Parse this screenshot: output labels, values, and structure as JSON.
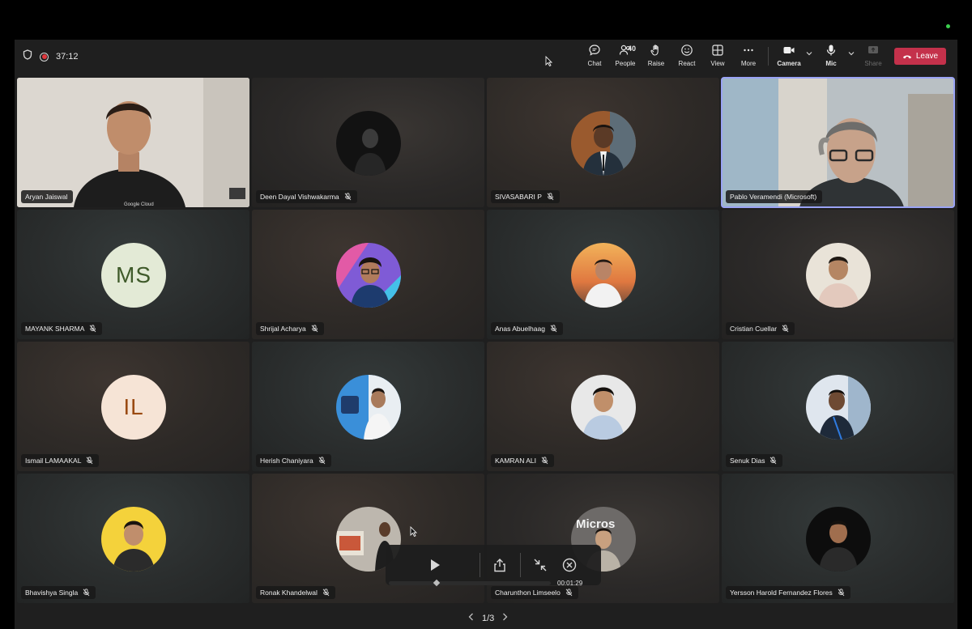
{
  "topbar": {
    "timer": "37:12",
    "buttons": {
      "chat": "Chat",
      "people": "People",
      "people_count": "40",
      "raise": "Raise",
      "react": "React",
      "view": "View",
      "more": "More",
      "camera": "Camera",
      "mic": "Mic",
      "share": "Share"
    },
    "leave": "Leave"
  },
  "colors": {
    "leave_button": "#c4314b",
    "selected_outline": "#9aa3f5",
    "recording_dot": "#e0383e"
  },
  "participants": [
    {
      "name": "Aryan Jaiswal",
      "type": "video",
      "muted": false
    },
    {
      "name": "Deen Dayal Vishwakarma",
      "type": "photo",
      "muted": true
    },
    {
      "name": "SIVASABARI P",
      "type": "photo",
      "muted": true
    },
    {
      "name": "Pablo Veramendi (Microsoft)",
      "type": "video",
      "muted": false,
      "active_speaker": true
    },
    {
      "name": "MAYANK SHARMA",
      "type": "initials",
      "initials": "MS",
      "muted": true
    },
    {
      "name": "Shrijal Acharya",
      "type": "photo",
      "muted": true
    },
    {
      "name": "Anas Abuelhaag",
      "type": "photo",
      "muted": true
    },
    {
      "name": "Cristian Cuellar",
      "type": "photo",
      "muted": true
    },
    {
      "name": "Ismail LAMAAKAL",
      "type": "initials",
      "initials": "IL",
      "muted": true
    },
    {
      "name": "Herish Chaniyara",
      "type": "photo",
      "muted": true
    },
    {
      "name": "KAMRAN ALI",
      "type": "photo",
      "muted": true
    },
    {
      "name": "Senuk Dias",
      "type": "photo",
      "muted": true
    },
    {
      "name": "Bhavishya Singla",
      "type": "photo",
      "muted": true
    },
    {
      "name": "Ronak Khandelwal",
      "type": "photo",
      "muted": true
    },
    {
      "name": "Charunthon Limseelo",
      "type": "photo",
      "muted": true
    },
    {
      "name": "Yersson Harold Fernandez Flores",
      "type": "photo",
      "muted": true
    }
  ],
  "pager": {
    "label": "1/3"
  },
  "player": {
    "time": "00:01:29",
    "progress": 0.29
  }
}
